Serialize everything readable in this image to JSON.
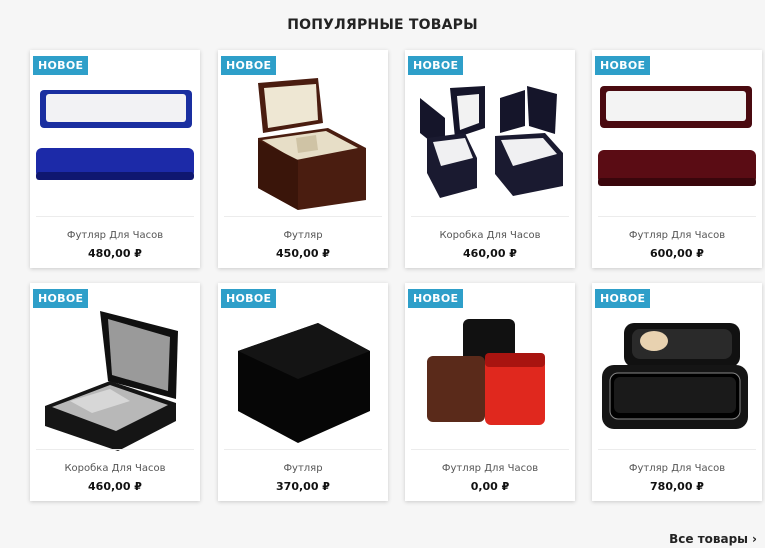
{
  "section": {
    "title": "ПОПУЛЯРНЫЕ ТОВАРЫ"
  },
  "products": [
    {
      "badge": "НОВОЕ",
      "name": "Футляр Для Часов",
      "price": "480,00 ₽",
      "image": "blue-long-box"
    },
    {
      "badge": "НОВОЕ",
      "name": "Футляр",
      "price": "450,00 ₽",
      "image": "wood-square-box"
    },
    {
      "badge": "НОВОЕ",
      "name": "Коробка Для Часов",
      "price": "460,00 ₽",
      "image": "two-black-boxes"
    },
    {
      "badge": "НОВОЕ",
      "name": "Футляр Для Часов",
      "price": "600,00 ₽",
      "image": "burgundy-long-box"
    },
    {
      "badge": "НОВОЕ",
      "name": "Коробка Для Часов",
      "price": "460,00 ₽",
      "image": "black-open-box"
    },
    {
      "badge": "НОВОЕ",
      "name": "Футляр",
      "price": "370,00 ₽",
      "image": "black-velvet-box"
    },
    {
      "badge": "НОВОЕ",
      "name": "Футляр Для Часов",
      "price": "0,00 ₽",
      "image": "leather-cube-boxes"
    },
    {
      "badge": "НОВОЕ",
      "name": "Футляр Для Часов",
      "price": "780,00 ₽",
      "image": "zip-travel-case"
    }
  ],
  "footer": {
    "all_products_label": "Все товары",
    "arrow": "›"
  },
  "colors": {
    "badge": "#2e9fc9",
    "background": "#f6f6f6"
  }
}
